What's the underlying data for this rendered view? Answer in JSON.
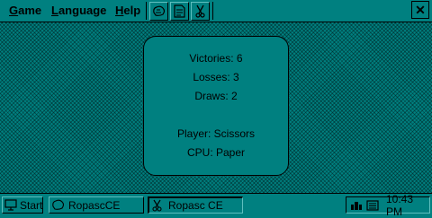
{
  "menu": {
    "game": {
      "u": "G",
      "rest": "ame"
    },
    "language": {
      "u": "L",
      "rest": "anguage"
    },
    "help": {
      "u": "H",
      "rest": "elp"
    }
  },
  "toolbar": {
    "icons": [
      "rock-icon",
      "paper-icon",
      "scissors-icon"
    ],
    "close_glyph": "✕"
  },
  "stats": {
    "victories": "Victories: 6",
    "losses": "Losses: 3",
    "draws": "Draws: 2",
    "player": "Player: Scissors",
    "cpu": "CPU: Paper"
  },
  "taskbar": {
    "start_label": "Start",
    "tasks": [
      {
        "label": "RopascCE",
        "icon": "app-window-icon",
        "active": false
      },
      {
        "label": "Ropasc CE",
        "icon": "scissors-app-icon",
        "active": true
      }
    ],
    "tray": {
      "time": "10:43 PM",
      "icons": [
        "network-icon",
        "keyboard-icon"
      ]
    }
  },
  "colors": {
    "background": "#008080",
    "text": "#000000",
    "highlight": "#5fbfbf"
  }
}
